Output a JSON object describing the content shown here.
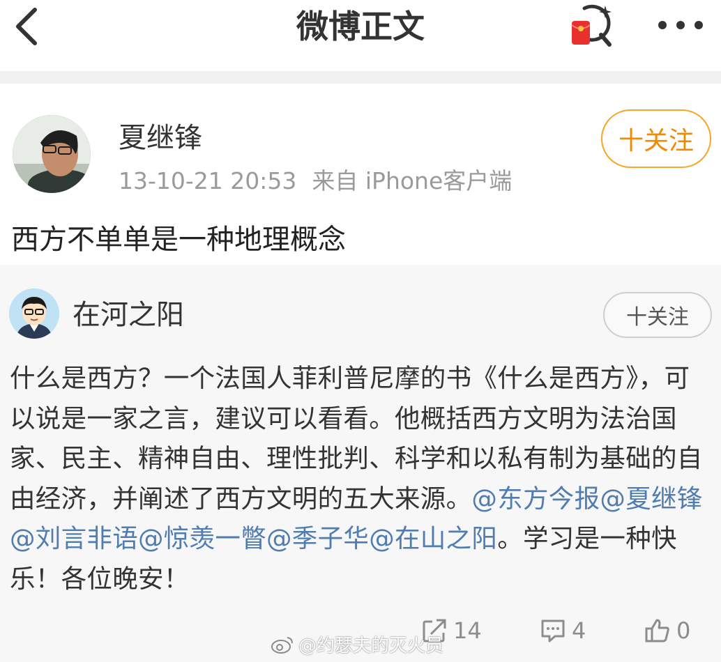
{
  "nav": {
    "title": "微博正文"
  },
  "post": {
    "author": {
      "name": "夏继锋",
      "time": "13-10-21 20:53",
      "source": "来自 iPhone客户端",
      "follow_label": "十关注"
    },
    "text": "西方不单单是一种地理概念"
  },
  "repost": {
    "author": {
      "name": "在河之阳",
      "follow_label": "十关注"
    },
    "body_pre": "什么是西方？一个法国人菲利普尼摩的书《什么是西方》，可以说是一家之言，建议可以看看。他概括西方文明为法治国家、民主、精神自由、理性批判、科学和以私有制为基础的自由经济，并阐述了西方文明的五大来源。",
    "mentions": [
      "@东方今报",
      "@夏继锋",
      "@刘言非语",
      "@惊羡一瞥",
      "@季子华",
      "@在山之阳"
    ],
    "body_post": "。学习是一种快乐！各位晚安！",
    "stats": {
      "reposts": "14",
      "comments": "4",
      "likes": "0"
    }
  },
  "watermark": "@约瑟夫的灭火员",
  "colors": {
    "follow_orange": "#f08a00",
    "mention_blue": "#507daf",
    "meta_gray": "#9a9a9a",
    "card_bg": "#f7f7f7"
  },
  "icons": {
    "back": "chevron-left-icon",
    "red_packet": "red-packet-search-icon",
    "more": "more-dots-icon",
    "share": "share-icon",
    "comment": "comment-icon",
    "like": "thumbs-up-icon"
  }
}
